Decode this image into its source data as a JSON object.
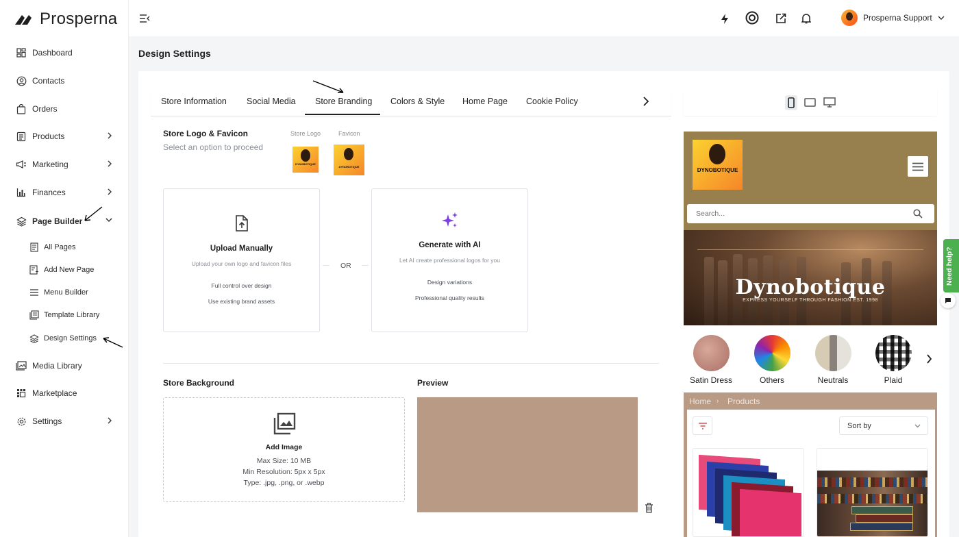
{
  "brand": {
    "name": "Prosperna"
  },
  "sidebar": {
    "items": [
      {
        "label": "Dashboard",
        "icon": "dashboard-icon"
      },
      {
        "label": "Contacts",
        "icon": "contacts-icon"
      },
      {
        "label": "Orders",
        "icon": "orders-icon"
      },
      {
        "label": "Products",
        "icon": "products-icon"
      },
      {
        "label": "Marketing",
        "icon": "megaphone-icon"
      },
      {
        "label": "Finances",
        "icon": "bar-chart-icon"
      },
      {
        "label": "Page Builder",
        "icon": "layers-icon"
      },
      {
        "label": "Media Library",
        "icon": "image-library-icon"
      },
      {
        "label": "Marketplace",
        "icon": "marketplace-icon"
      },
      {
        "label": "Settings",
        "icon": "gear-icon"
      }
    ],
    "page_builder_sub": [
      {
        "label": "All Pages"
      },
      {
        "label": "Add New Page"
      },
      {
        "label": "Menu Builder"
      },
      {
        "label": "Template Library"
      },
      {
        "label": "Design Settings"
      }
    ]
  },
  "header": {
    "user_name": "Prosperna Support"
  },
  "page": {
    "title": "Design Settings"
  },
  "tabs": [
    "Store Information",
    "Social Media",
    "Store Branding",
    "Colors & Style",
    "Home Page",
    "Cookie Policy"
  ],
  "active_tab": "Store Branding",
  "logo_section": {
    "title": "Store Logo & Favicon",
    "subtitle": "Select an option to proceed",
    "logo_label": "Store Logo",
    "favicon_label": "Favicon",
    "thumb_text": "DYNOBOTIQUE"
  },
  "upload_card": {
    "title": "Upload Manually",
    "subtitle": "Upload your own logo and favicon files",
    "features": [
      "Full control over design",
      "Use existing brand assets"
    ]
  },
  "ai_card": {
    "title": "Generate with AI",
    "subtitle": "Let AI create professional logos for you",
    "features": [
      "Design variations",
      "Professional quality results"
    ]
  },
  "or_label": "OR",
  "background_section": {
    "title": "Store Background",
    "preview_title": "Preview",
    "add_image": "Add Image",
    "max_size": "Max Size: 10 MB",
    "min_res": "Min Resolution: 5px x 5px",
    "types": "Type: .jpg, .png, or .webp",
    "preview_color": "#b89a85"
  },
  "store_preview": {
    "logo_text": "DYNOBOTIQUE",
    "search_placeholder": "Search...",
    "banner_title": "Dynobotique",
    "banner_subtitle": "EXPRESS YOURSELF THROUGH FASHION EST. 1998",
    "categories": [
      "Satin Dress",
      "Others",
      "Neutrals",
      "Plaid"
    ],
    "breadcrumb": [
      "Home",
      "Products"
    ],
    "sort_label": "Sort by",
    "header_color": "#97804d"
  },
  "help": {
    "label": "Need help?"
  },
  "colors": {
    "accent": "#222222",
    "help_green": "#4caf50",
    "ai_purple": "#7b3fe4"
  }
}
